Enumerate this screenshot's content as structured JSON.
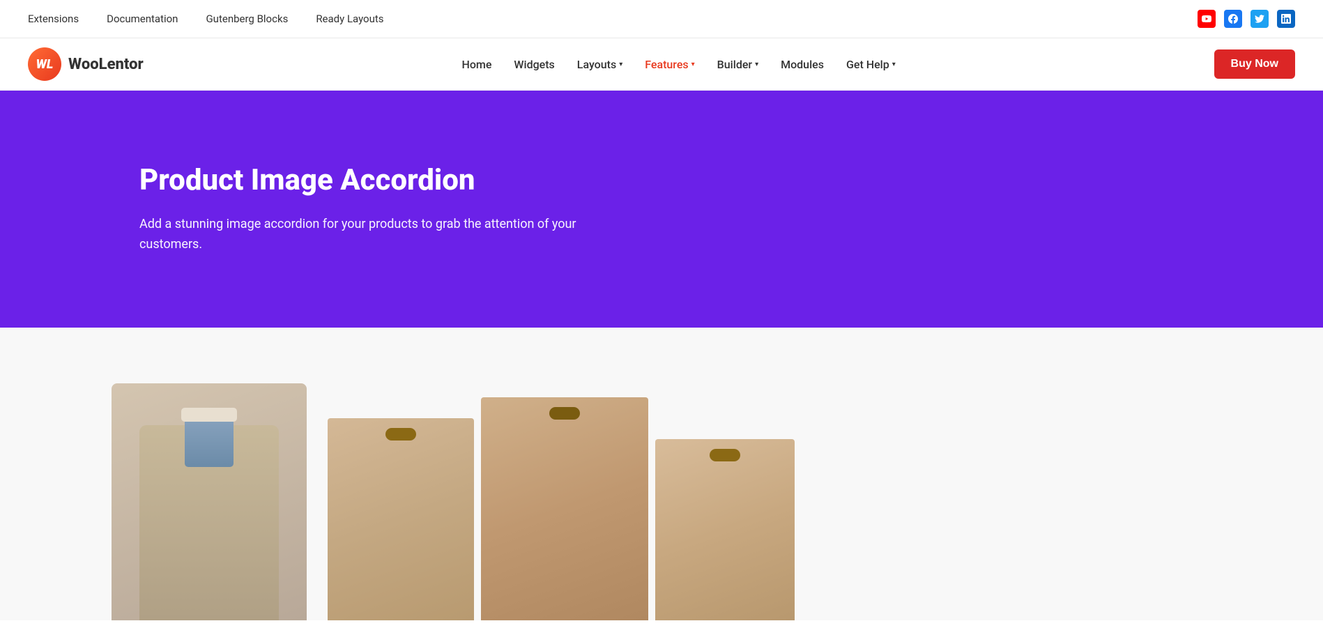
{
  "topbar": {
    "nav_items": [
      {
        "label": "Extensions",
        "href": "#"
      },
      {
        "label": "Documentation",
        "href": "#"
      },
      {
        "label": "Gutenberg Blocks",
        "href": "#"
      },
      {
        "label": "Ready Layouts",
        "href": "#"
      }
    ],
    "social": [
      {
        "name": "youtube",
        "label": "Y",
        "title": "YouTube"
      },
      {
        "name": "facebook",
        "label": "f",
        "title": "Facebook"
      },
      {
        "name": "twitter",
        "label": "t",
        "title": "Twitter"
      },
      {
        "name": "linkedin",
        "label": "in",
        "title": "LinkedIn"
      }
    ]
  },
  "mainnav": {
    "logo_initials": "WL",
    "logo_brand_pre": "Woo",
    "logo_brand_post": "Lentor",
    "nav_items": [
      {
        "label": "Home",
        "href": "#",
        "active": false,
        "has_dropdown": false
      },
      {
        "label": "Widgets",
        "href": "#",
        "active": false,
        "has_dropdown": false
      },
      {
        "label": "Layouts",
        "href": "#",
        "active": false,
        "has_dropdown": true
      },
      {
        "label": "Features",
        "href": "#",
        "active": true,
        "has_dropdown": true
      },
      {
        "label": "Builder",
        "href": "#",
        "active": false,
        "has_dropdown": true
      },
      {
        "label": "Modules",
        "href": "#",
        "active": false,
        "has_dropdown": false
      },
      {
        "label": "Get Help",
        "href": "#",
        "active": false,
        "has_dropdown": true
      }
    ],
    "buy_now_label": "Buy Now"
  },
  "hero": {
    "title": "Product Image Accordion",
    "description": "Add a stunning image accordion for your products to grab the attention of your customers.",
    "bg_color": "#6b21e8"
  },
  "product_section": {
    "bg_color": "#f8f8f8"
  }
}
